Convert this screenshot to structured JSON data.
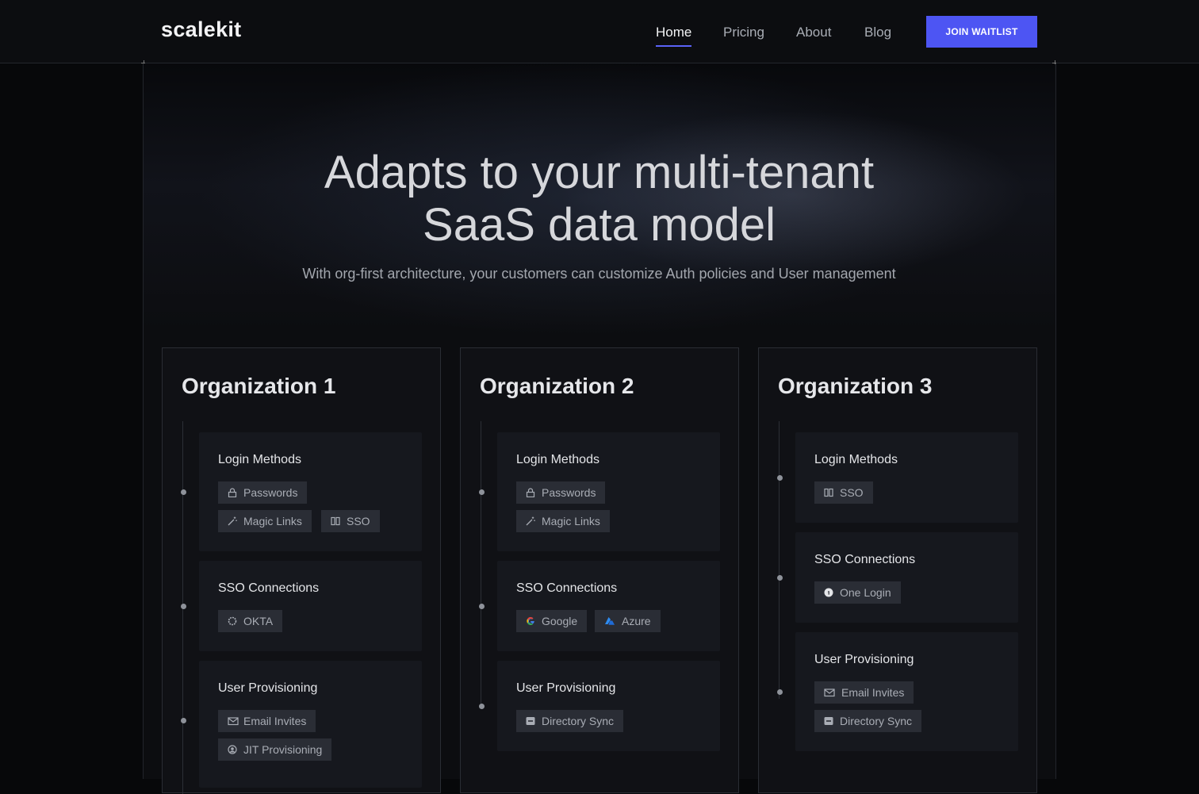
{
  "brand": {
    "logo": "scalekit"
  },
  "nav": {
    "links": [
      "Home",
      "Pricing",
      "About",
      "Blog"
    ],
    "active": "Home",
    "cta": "JOIN WAITLIST"
  },
  "hero": {
    "title_line1": "Adapts to your multi-tenant",
    "title_line2": "SaaS data model",
    "subtitle": "With org-first architecture, your customers can customize Auth policies and User management"
  },
  "orgs": [
    {
      "title": "Organization 1",
      "sections": [
        {
          "title": "Login Methods",
          "tags": [
            {
              "label": "Passwords",
              "icon": "lock-icon"
            },
            {
              "label": "Magic Links",
              "icon": "magic-wand-icon"
            },
            {
              "label": "SSO",
              "icon": "sso-icon"
            }
          ]
        },
        {
          "title": "SSO Connections",
          "tags": [
            {
              "label": "OKTA",
              "icon": "okta-icon"
            }
          ]
        },
        {
          "title": "User Provisioning",
          "tags": [
            {
              "label": "Email Invites",
              "icon": "mail-icon"
            },
            {
              "label": "JIT Provisioning",
              "icon": "jit-user-icon"
            }
          ]
        }
      ]
    },
    {
      "title": "Organization 2",
      "sections": [
        {
          "title": "Login Methods",
          "tags": [
            {
              "label": "Passwords",
              "icon": "lock-icon"
            },
            {
              "label": "Magic Links",
              "icon": "magic-wand-icon"
            }
          ]
        },
        {
          "title": "SSO Connections",
          "tags": [
            {
              "label": "Google",
              "icon": "google-icon"
            },
            {
              "label": "Azure",
              "icon": "azure-icon"
            }
          ]
        },
        {
          "title": "User Provisioning",
          "tags": [
            {
              "label": "Directory Sync",
              "icon": "directory-icon"
            }
          ]
        }
      ]
    },
    {
      "title": "Organization 3",
      "sections": [
        {
          "title": "Login Methods",
          "tags": [
            {
              "label": "SSO",
              "icon": "sso-icon"
            }
          ]
        },
        {
          "title": "SSO Connections",
          "tags": [
            {
              "label": "One Login",
              "icon": "onelogin-icon"
            }
          ]
        },
        {
          "title": "User Provisioning",
          "tags": [
            {
              "label": "Email Invites",
              "icon": "mail-icon"
            },
            {
              "label": "Directory Sync",
              "icon": "directory-icon"
            }
          ]
        }
      ]
    }
  ],
  "colors": {
    "accent": "#4d55f3",
    "background": "#0c0d10",
    "card": "#16181e",
    "tag": "#2a2d35"
  }
}
